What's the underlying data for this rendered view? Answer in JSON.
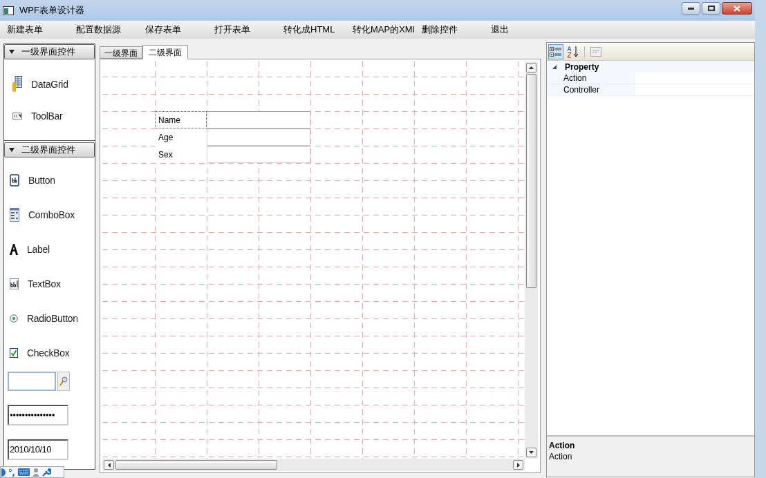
{
  "window": {
    "title": "WPF表单设计器"
  },
  "menu": [
    "新建表单",
    "配置数据源",
    "保存表单",
    "打开表单",
    "转化成HTML",
    "转化MAP的XMl",
    "删除控件",
    "退出"
  ],
  "toolbox": [
    {
      "title": "一级界面控件",
      "expanded": true,
      "items": [
        {
          "label": "DataGrid",
          "kind": "datagrid"
        },
        {
          "label": "ToolBar",
          "kind": "toolbar"
        }
      ]
    },
    {
      "title": "二级界面控件",
      "expanded": true,
      "items": [
        {
          "label": "Button",
          "kind": "button"
        },
        {
          "label": "ComboBox",
          "kind": "combobox"
        },
        {
          "label": "Label",
          "kind": "label"
        },
        {
          "label": "TextBox",
          "kind": "textbox"
        },
        {
          "label": "RadioButton",
          "kind": "radio"
        },
        {
          "label": "CheckBox",
          "kind": "checkbox"
        }
      ]
    }
  ],
  "sample_controls": [
    {
      "kind": "search"
    },
    {
      "kind": "password",
      "value": "●●●●●●●●●●●●●●●"
    },
    {
      "kind": "date",
      "value": "2010/10/10"
    }
  ],
  "tabs": [
    {
      "label": "一级界面",
      "selected": false
    },
    {
      "label": "二级界面",
      "selected": true
    }
  ],
  "form_fields": [
    {
      "label": "Name",
      "selected": true
    },
    {
      "label": "Age",
      "selected": false
    },
    {
      "label": "Sex",
      "selected": false
    }
  ],
  "property_toolbar": [
    {
      "kind": "categorized",
      "selected": true
    },
    {
      "kind": "alphabetical",
      "selected": false
    },
    {
      "kind": "pages",
      "selected": false
    }
  ],
  "property_grid": {
    "category": "Property",
    "expanded": true,
    "rows": [
      "Action",
      "Controller"
    ]
  },
  "description": {
    "title": "Action",
    "text": "Action"
  }
}
